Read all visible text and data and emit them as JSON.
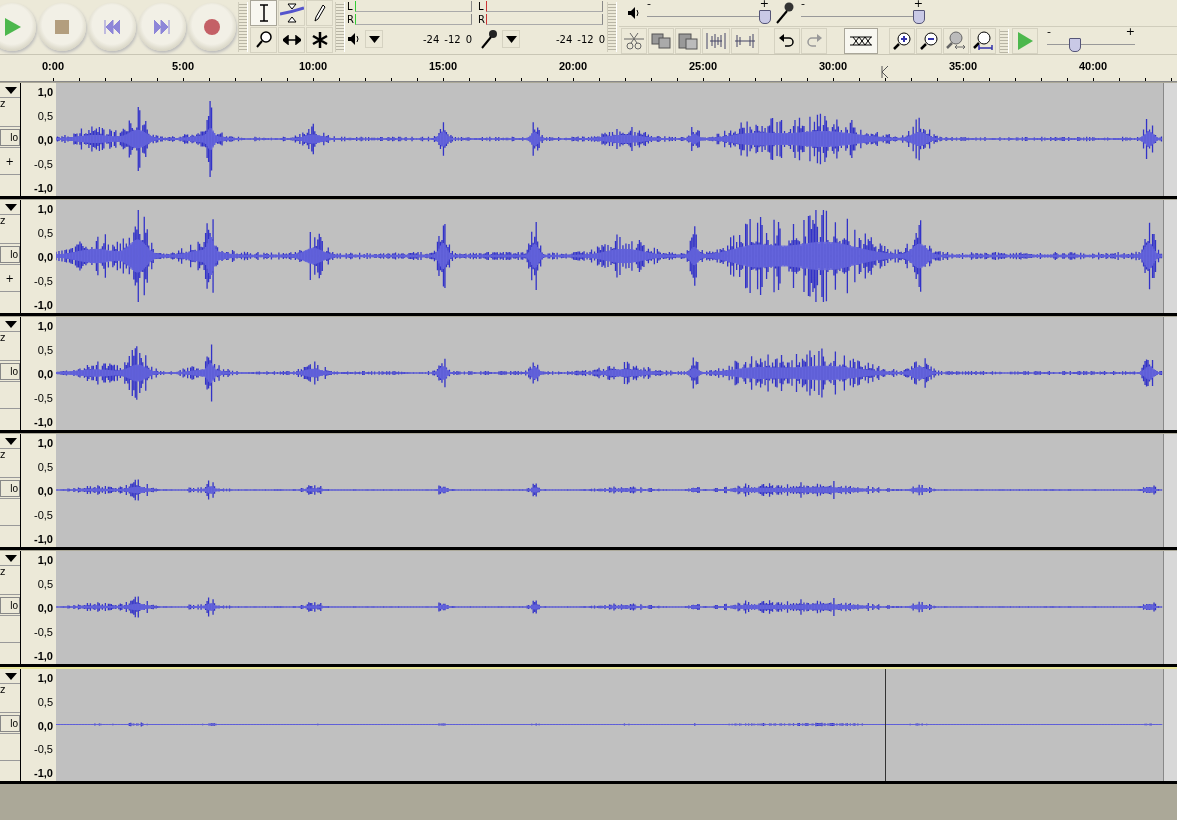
{
  "transport": {
    "buttons": [
      {
        "kind": "play"
      },
      {
        "kind": "stop"
      },
      {
        "kind": "skip-start"
      },
      {
        "kind": "skip-end"
      },
      {
        "kind": "record"
      }
    ]
  },
  "tools": [
    {
      "kind": "select",
      "selected": true
    },
    {
      "kind": "envelope",
      "selected": false
    },
    {
      "kind": "draw",
      "selected": false
    },
    {
      "kind": "zoom",
      "selected": false
    },
    {
      "kind": "timeshift",
      "selected": false
    },
    {
      "kind": "multi",
      "selected": false
    }
  ],
  "meters": [
    {
      "kind": "output",
      "left": "L",
      "right": "R",
      "scale": [
        "-24",
        "-12",
        "0"
      ]
    },
    {
      "kind": "input",
      "left": "L",
      "right": "R",
      "scale": [
        "-24",
        "-12",
        "0"
      ]
    }
  ],
  "mixer": [
    {
      "kind": "output",
      "minus": "-",
      "plus": "+",
      "level": 0.97
    },
    {
      "kind": "input",
      "minus": "-",
      "plus": "+",
      "level": 0.97
    }
  ],
  "edit_tools": [
    {
      "kind": "cut"
    },
    {
      "kind": "copy"
    },
    {
      "kind": "paste"
    },
    {
      "kind": "trim"
    },
    {
      "kind": "silence"
    },
    {
      "kind": "undo",
      "disabled": false
    },
    {
      "kind": "redo",
      "disabled": true
    },
    {
      "kind": "sync"
    },
    {
      "kind": "zoom-in"
    },
    {
      "kind": "zoom-out"
    },
    {
      "kind": "fit-selection"
    },
    {
      "kind": "fit-project"
    }
  ],
  "play_at_speed": {
    "minus": "-",
    "plus": "+",
    "level": 0.32
  },
  "ruler": {
    "labels": [
      "0:00",
      "5:00",
      "10:00",
      "15:00",
      "20:00",
      "25:00",
      "30:00",
      "35:00",
      "40:00"
    ]
  },
  "tracks": [
    {
      "selected": false,
      "cursor": false,
      "rate": "z",
      "solo": "lo",
      "pan": "+",
      "scale": [
        "1,0",
        "0,5",
        "0,0",
        "-0,5",
        "-1,0"
      ]
    },
    {
      "selected": false,
      "cursor": false,
      "rate": "z",
      "solo": "lo",
      "pan": "+",
      "scale": [
        "1,0",
        "0,5",
        "0,0",
        "-0,5",
        "-1,0"
      ]
    },
    {
      "selected": false,
      "cursor": false,
      "rate": "z",
      "solo": "lo",
      "scale": [
        "1,0",
        "0,5",
        "0,0",
        "-0,5",
        "-1,0"
      ]
    },
    {
      "selected": false,
      "cursor": false,
      "rate": "z",
      "solo": "lo",
      "scale": [
        "1,0",
        "0,5",
        "0,0",
        "-0,5",
        "-1,0"
      ]
    },
    {
      "selected": false,
      "cursor": false,
      "rate": "z",
      "solo": "lo",
      "scale": [
        "1,0",
        "0,5",
        "0,0",
        "-0,5",
        "-1,0"
      ]
    },
    {
      "selected": true,
      "cursor": true,
      "rate": "z",
      "solo": "lo",
      "scale": [
        "1,0",
        "0,5",
        "0,0",
        "-0,5",
        "-1,0"
      ]
    }
  ]
}
